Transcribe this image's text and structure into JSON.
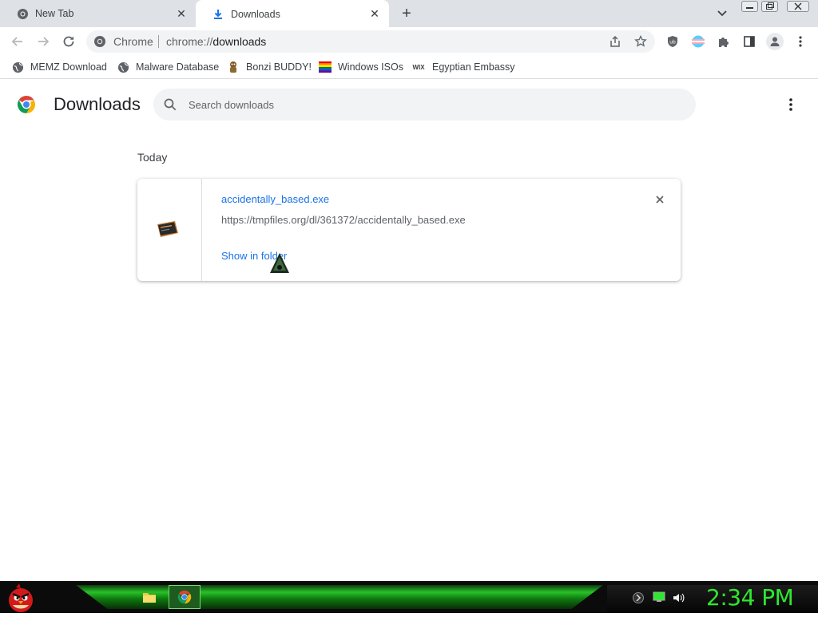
{
  "tabs": [
    {
      "label": "New Tab",
      "icon": "chrome-icon",
      "active": false
    },
    {
      "label": "Downloads",
      "icon": "download-icon",
      "active": true
    }
  ],
  "new_tab_symbol": "+",
  "tab_close_symbol": "✕",
  "omnibox": {
    "site_label": "Chrome",
    "url_scheme": "chrome://",
    "url_path": "downloads"
  },
  "bookmarks": [
    {
      "label": "MEMZ Download",
      "icon": "globe-icon"
    },
    {
      "label": "Malware Database",
      "icon": "globe-icon"
    },
    {
      "label": "Bonzi BUDDY!",
      "icon": "bonzi-icon"
    },
    {
      "label": "Windows ISOs",
      "icon": "rainbow-flag-icon"
    },
    {
      "label": "Egyptian Embassy",
      "icon": "wix-icon"
    }
  ],
  "wix_text": "WIX",
  "page": {
    "title": "Downloads",
    "search_placeholder": "Search downloads",
    "date_heading": "Today"
  },
  "download": {
    "file_name": "accidentally_based.exe",
    "url": "https://tmpfiles.org/dl/361372/accidentally_based.exe",
    "action": "Show in folder",
    "remove_symbol": "✕"
  },
  "taskbar": {
    "clock": "2:34 PM"
  },
  "colors": {
    "accent": "#1a73e8",
    "clock": "#2ee82e",
    "taskbar_glow": "#29c229"
  }
}
